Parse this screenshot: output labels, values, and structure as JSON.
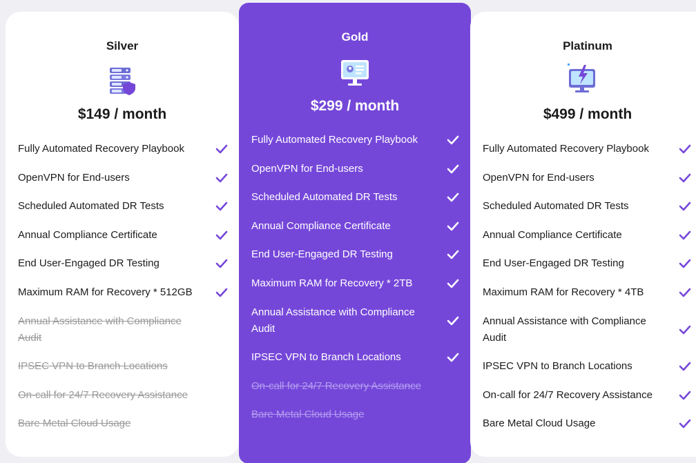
{
  "colors": {
    "accent_purple": "#7547d9",
    "check_purple": "#7547d9",
    "card_background": "#ffffff",
    "disabled_text": "#9a9a9a"
  },
  "plans": [
    {
      "key": "silver",
      "title": "Silver",
      "icon": "server-shield-icon",
      "price": "$149 / month",
      "features": [
        {
          "label": "Fully Automated Recovery Playbook",
          "included": true
        },
        {
          "label": "OpenVPN for End-users",
          "included": true
        },
        {
          "label": "Scheduled Automated DR Tests",
          "included": true
        },
        {
          "label": "Annual Compliance Certificate",
          "included": true
        },
        {
          "label": "End User-Engaged DR Testing",
          "included": true
        },
        {
          "label": "Maximum RAM for Recovery * 512GB",
          "included": true
        },
        {
          "label": "Annual Assistance with Compliance Audit",
          "included": false
        },
        {
          "label": "IPSEC VPN to Branch Locations",
          "included": false
        },
        {
          "label": "On-call for 24/7 Recovery Assistance",
          "included": false
        },
        {
          "label": "Bare Metal Cloud Usage",
          "included": false
        }
      ]
    },
    {
      "key": "gold",
      "title": "Gold",
      "icon": "monitor-dashboard-icon",
      "price": "$299 / month",
      "features": [
        {
          "label": "Fully Automated Recovery Playbook",
          "included": true
        },
        {
          "label": "OpenVPN for End-users",
          "included": true
        },
        {
          "label": "Scheduled Automated DR Tests",
          "included": true
        },
        {
          "label": "Annual Compliance Certificate",
          "included": true
        },
        {
          "label": "End User-Engaged DR Testing",
          "included": true
        },
        {
          "label": "Maximum RAM for Recovery * 2TB",
          "included": true
        },
        {
          "label": "Annual Assistance with Compliance Audit",
          "included": true
        },
        {
          "label": "IPSEC VPN to Branch Locations",
          "included": true
        },
        {
          "label": "On-call for 24/7 Recovery Assistance",
          "included": false
        },
        {
          "label": "Bare Metal Cloud Usage",
          "included": false
        }
      ]
    },
    {
      "key": "platinum",
      "title": "Platinum",
      "icon": "monitor-lightning-icon",
      "price": "$499 / month",
      "features": [
        {
          "label": "Fully Automated Recovery Playbook",
          "included": true
        },
        {
          "label": "OpenVPN for End-users",
          "included": true
        },
        {
          "label": "Scheduled Automated DR Tests",
          "included": true
        },
        {
          "label": "Annual Compliance Certificate",
          "included": true
        },
        {
          "label": "End User-Engaged DR Testing",
          "included": true
        },
        {
          "label": "Maximum RAM for Recovery * 4TB",
          "included": true
        },
        {
          "label": "Annual Assistance with Compliance Audit",
          "included": true
        },
        {
          "label": "IPSEC VPN to Branch Locations",
          "included": true
        },
        {
          "label": "On-call for 24/7 Recovery Assistance",
          "included": true
        },
        {
          "label": "Bare Metal Cloud Usage",
          "included": true
        }
      ]
    }
  ]
}
